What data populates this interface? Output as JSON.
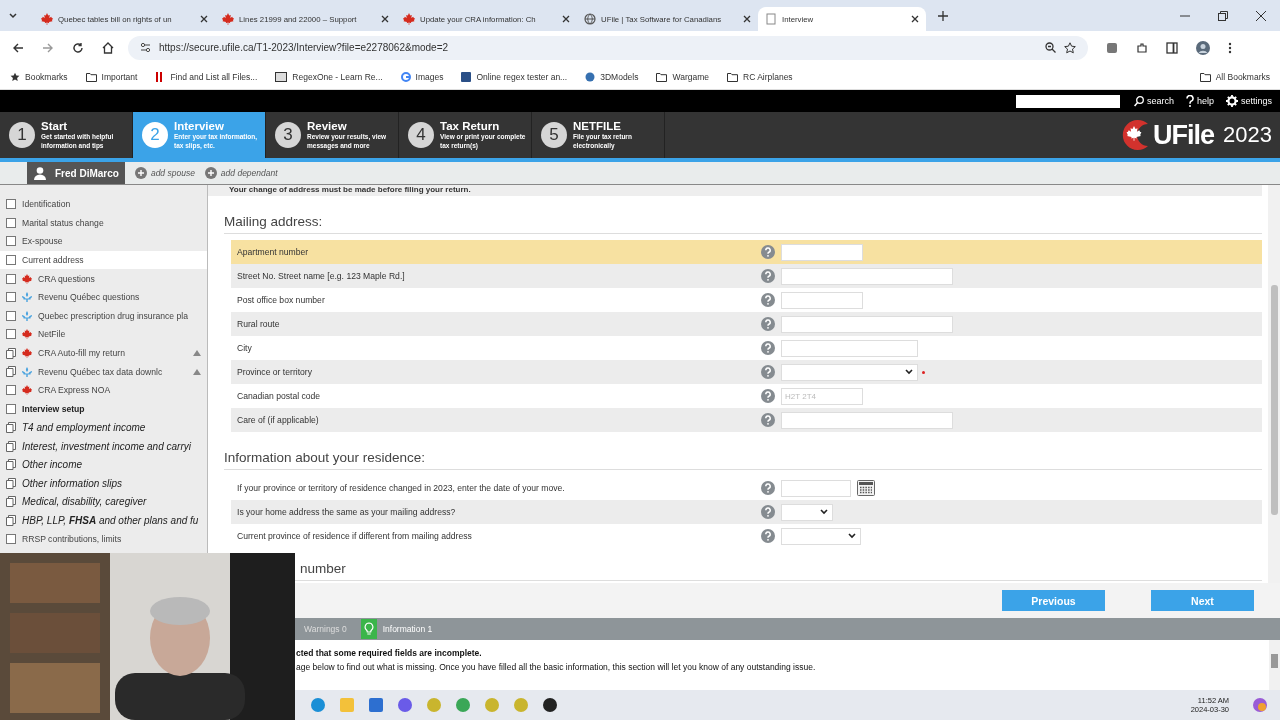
{
  "browser": {
    "tabs": [
      {
        "title": "Quebec tables bill on rights of un",
        "selected": false
      },
      {
        "title": "Lines 21999 and 22000 – Support",
        "selected": false
      },
      {
        "title": "Update your CRA information: Ch",
        "selected": false
      },
      {
        "title": "UFile | Tax Software for Canadians",
        "selected": false
      },
      {
        "title": "Interview",
        "selected": true
      }
    ],
    "url": "https://secure.ufile.ca/T1-2023/Interview?file=e2278062&mode=2",
    "bookmarks": [
      "Bookmarks",
      "Important",
      "Find and List all Files...",
      "RegexOne - Learn Re...",
      "Images",
      "Online regex tester an...",
      "3DModels",
      "Wargame",
      "RC Airplanes"
    ],
    "all_bookmarks": "All Bookmarks"
  },
  "topbar": {
    "links": [
      "search",
      "help",
      "settings"
    ]
  },
  "steps": [
    {
      "number": "1",
      "title": "Start",
      "subtitle": "Get started with helpful information and tips",
      "selected": false
    },
    {
      "number": "2",
      "title": "Interview",
      "subtitle": "Enter your tax information, tax slips, etc.",
      "selected": true
    },
    {
      "number": "3",
      "title": "Review",
      "subtitle": "Review your results, view messages and more",
      "selected": false
    },
    {
      "number": "4",
      "title": "Tax Return",
      "subtitle": "View or print your complete tax return(s)",
      "selected": false
    },
    {
      "number": "5",
      "title": "NETFILE",
      "subtitle": "File your tax return electronically",
      "selected": false
    }
  ],
  "logo": {
    "name": "UFile",
    "year": "2023"
  },
  "people": {
    "current": "Fred DiMarco",
    "actions": [
      "add spouse",
      "add dependant"
    ]
  },
  "sidebar": {
    "items": [
      {
        "label": "Identification",
        "kind": "plain",
        "selected": false
      },
      {
        "label": "Marital status change",
        "kind": "plain",
        "selected": false
      },
      {
        "label": "Ex-spouse",
        "kind": "plain",
        "selected": false
      },
      {
        "label": "Current address",
        "kind": "plain",
        "selected": true
      },
      {
        "label": "CRA questions",
        "kind": "federal",
        "selected": false
      },
      {
        "label": "Revenu Québec questions",
        "kind": "quebec",
        "selected": false
      },
      {
        "label": "Quebec prescription drug insurance pla",
        "kind": "quebec",
        "selected": false
      },
      {
        "label": "NetFile",
        "kind": "federal",
        "selected": false
      },
      {
        "label": "CRA Auto-fill my return",
        "kind": "federalgroup",
        "selected": false,
        "collapsible": true
      },
      {
        "label": "Revenu Québec tax data downlc",
        "kind": "quebecgroup",
        "selected": false,
        "collapsible": true
      },
      {
        "label": "CRA Express NOA",
        "kind": "federal",
        "selected": false
      },
      {
        "label": "Interview setup",
        "kind": "setup",
        "selected": false
      },
      {
        "label": "T4 and employment income",
        "kind": "slips",
        "selected": false
      },
      {
        "label": "Interest, investment income and carryi",
        "kind": "slips",
        "selected": false
      },
      {
        "label": "Other income",
        "kind": "slips",
        "selected": false
      },
      {
        "label": "Other information slips",
        "kind": "slips",
        "selected": false
      },
      {
        "label": "Medical, disability, caregiver",
        "kind": "slips",
        "selected": false
      },
      {
        "label": "HBP, LLP, **FHSA** and other plans and fu",
        "kind": "slips",
        "selected": false
      },
      {
        "label": "RRSP contributions, limits",
        "kind": "plain",
        "selected": false
      }
    ]
  },
  "form": {
    "notice": "Your change of address must be made before filing your return.",
    "sections": [
      {
        "heading": "Mailing address:",
        "rows": [
          {
            "label": "Apartment number",
            "kind": "text",
            "selected": true
          },
          {
            "label": "Street No. Street name [e.g. 123 Maple Rd.]",
            "kind": "text",
            "selected": false
          },
          {
            "label": "Post office box number",
            "kind": "text",
            "selected": false
          },
          {
            "label": "Rural route",
            "kind": "text",
            "selected": false
          },
          {
            "label": "City",
            "kind": "text",
            "selected": false
          },
          {
            "label": "Province or territory",
            "kind": "select",
            "required": true,
            "selected": false
          },
          {
            "label": "Canadian postal code",
            "kind": "text",
            "placeholder": "H2T 2T4",
            "selected": false
          },
          {
            "label": "Care of (if applicable)",
            "kind": "text",
            "selected": false
          }
        ]
      },
      {
        "heading": "Information about your residence:",
        "rows": [
          {
            "label": "If your province or territory of residence changed in 2023, enter the date of your move.",
            "kind": "date",
            "selected": false
          },
          {
            "label": "Is your home address the same as your mailing address?",
            "kind": "select",
            "selected": false
          },
          {
            "label": "Current province of residence if different from mailing address",
            "kind": "select",
            "selected": false
          }
        ]
      },
      {
        "heading": "number"
      }
    ]
  },
  "nav_buttons": [
    "Previous",
    "Next"
  ],
  "messages": {
    "tabs": [
      {
        "label": "Warnings 0",
        "kind": "warning",
        "selected": false
      },
      {
        "label": "Information 1",
        "kind": "info",
        "selected": true
      }
    ],
    "title": "cted that some required fields are incomplete.",
    "body": "age below to find out what is missing. Once you have filled all the basic information, this section will let you know of any outstanding issue."
  },
  "taskbar": {
    "time": "11:52 AM",
    "date": "2024-03-30"
  },
  "webcam": {
    "kind": "picture"
  }
}
